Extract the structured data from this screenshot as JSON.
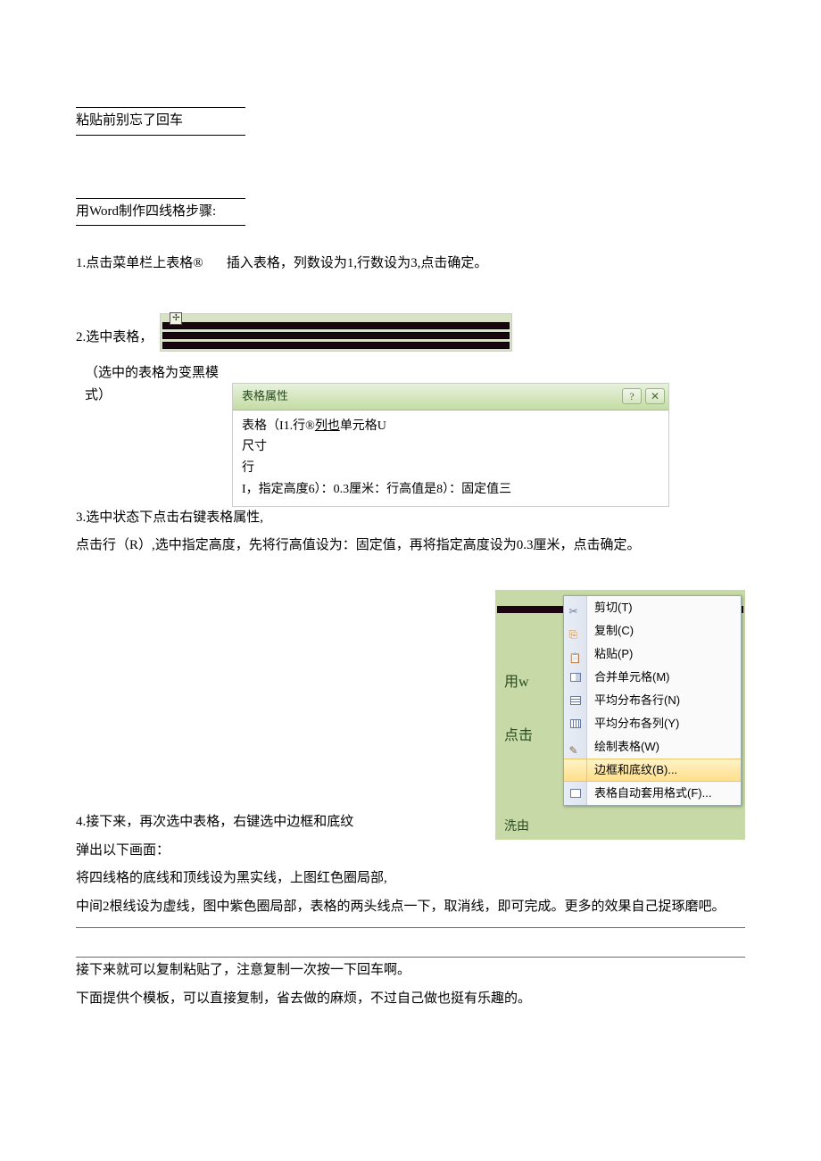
{
  "topNote": "粘贴前别忘了回车",
  "title": "用Word制作四线格步骤:",
  "step1": "1.点击菜单栏上表格®       插入表格，列数设为1,行数设为3,点击确定。",
  "step2": "2.选中表格，",
  "step2Paren": "（选中的表格为变黑模式）",
  "handleSymbol": "✢",
  "dialog": {
    "title": "表格属性",
    "helpGlyph": "?",
    "closeGlyph": "✕",
    "line1_a": "表格（I1.行®",
    "line1_b": "列也",
    "line1_c": "单元格U",
    "line2": "尺寸",
    "line3": "行",
    "line4": "I，指定高度6）：0.3厘米：行高值是8）：固定值三"
  },
  "step3a": "3.选中状态下点击右键表格属性,",
  "step3b": "点击行（R）,选中指定高度，先将行高值设为：固定值，再将指定高度设为0.3厘米，点击确定。",
  "context": {
    "bg1": "用w",
    "bg2": "点击",
    "bg3": "洗由",
    "bgRight": "，",
    "items": [
      {
        "icon": "cut",
        "label": "剪切(T)"
      },
      {
        "icon": "copy",
        "label": "复制(C)"
      },
      {
        "icon": "paste",
        "label": "粘贴(P)"
      },
      {
        "icon": "merge",
        "label": "合并单元格(M)"
      },
      {
        "icon": "distrow",
        "label": "平均分布各行(N)"
      },
      {
        "icon": "distcol",
        "label": "平均分布各列(Y)"
      },
      {
        "icon": "draw",
        "label": "绘制表格(W)"
      },
      {
        "icon": "",
        "label": "边框和底纹(B)...",
        "hl": true
      },
      {
        "icon": "autofmt",
        "label": "表格自动套用格式(F)..."
      }
    ]
  },
  "step4a": "4.接下来，再次选中表格，右键选中边框和底纹",
  "step4b": "弹出以下画面：",
  "step4c": "将四线格的底线和顶线设为黑实线，上图红色圈局部,",
  "step4d": "中间2根线设为虚线，图中紫色圈局部，表格的两头线点一下，取消线，即可完成。更多的效果自己捉琢磨吧。",
  "footer1": "接下来就可以复制粘贴了，注意复制一次按一下回车啊。",
  "footer2": "下面提供个模板，可以直接复制，省去做的麻烦，不过自己做也挺有乐趣的。"
}
